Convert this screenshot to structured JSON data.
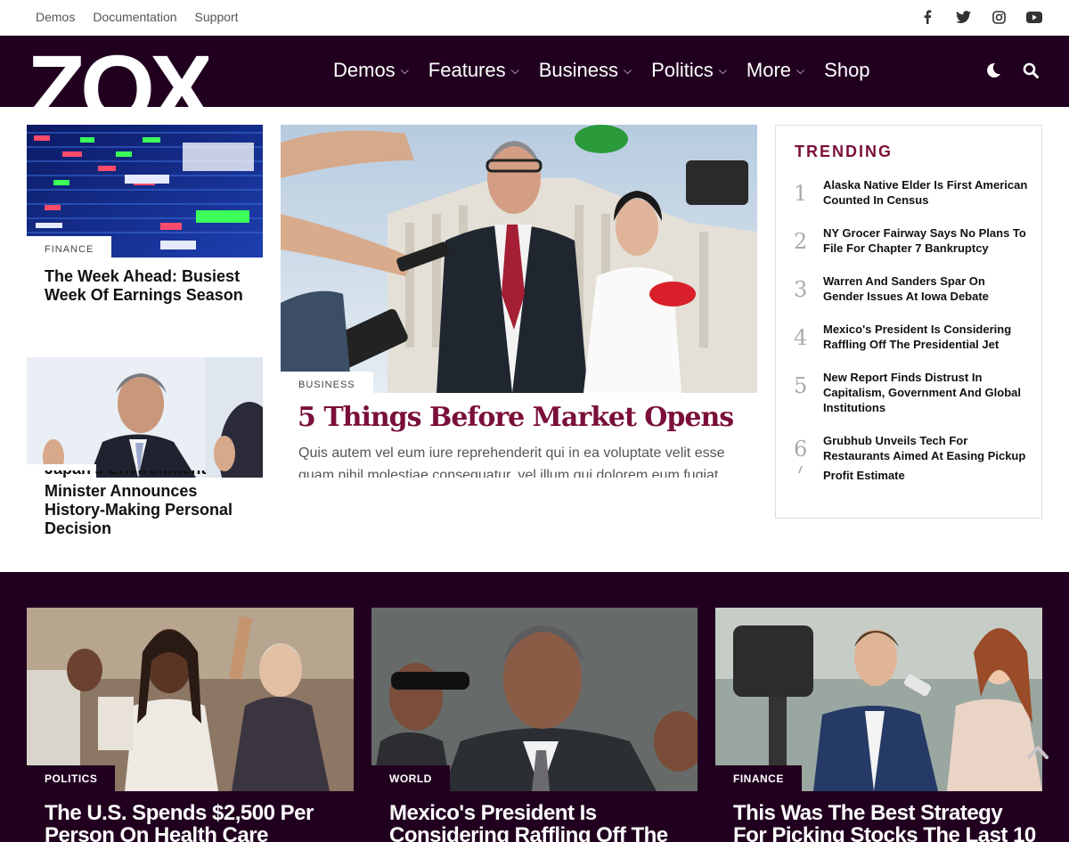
{
  "topbar": {
    "links": [
      "Demos",
      "Documentation",
      "Support"
    ],
    "social_icons": [
      "facebook-icon",
      "twitter-icon",
      "instagram-icon",
      "youtube-icon"
    ]
  },
  "nav": {
    "logo": "ZOX",
    "menu": [
      {
        "label": "Demos",
        "has_dropdown": true
      },
      {
        "label": "Features",
        "has_dropdown": true
      },
      {
        "label": "Business",
        "has_dropdown": true
      },
      {
        "label": "Politics",
        "has_dropdown": true
      },
      {
        "label": "More",
        "has_dropdown": true
      },
      {
        "label": "Shop",
        "has_dropdown": false
      }
    ],
    "icons": [
      "moon-icon",
      "search-icon"
    ],
    "chevron": "⌄"
  },
  "featured": {
    "left_top": {
      "category": "FINANCE",
      "title": "The Week Ahead: Busiest Week Of Earnings Season"
    },
    "left_bottom": {
      "category": "",
      "title_clipped": "Japan's Environment",
      "title": "Minister Announces History-Making Personal Decision"
    },
    "lead": {
      "category": "BUSINESS",
      "title": "5 Things Before Market Opens",
      "excerpt": "Quis autem vel eum iure reprehenderit qui in ea voluptate velit esse quam nihil molestiae consequatur, vel illum qui dolorem eum fugiat."
    }
  },
  "trending": {
    "heading": "TRENDING",
    "items": [
      {
        "num": "1",
        "title": "Alaska Native Elder Is First American Counted In Census"
      },
      {
        "num": "2",
        "title": "NY Grocer Fairway Says No Plans To File For Chapter 7 Bankruptcy"
      },
      {
        "num": "3",
        "title": "Warren And Sanders Spar On Gender Issues At Iowa Debate"
      },
      {
        "num": "4",
        "title": "Mexico's President Is Considering Raffling Off The Presidential Jet"
      },
      {
        "num": "5",
        "title": "New Report Finds Distrust In Capitalism, Government And Global Institutions"
      },
      {
        "num": "6",
        "title": "Grubhub Unveils Tech For Restaurants Aimed At Easing Pickup Orders"
      },
      {
        "num": "7",
        "title": "Profit Estimate"
      }
    ]
  },
  "band": {
    "cards": [
      {
        "category": "POLITICS",
        "title": "The U.S. Spends $2,500 Per Person On Health Care"
      },
      {
        "category": "WORLD",
        "title": "Mexico's President Is Considering Raffling Off The"
      },
      {
        "category": "FINANCE",
        "title": "This Was The Best Strategy For Picking Stocks The Last 10"
      }
    ]
  },
  "colors": {
    "brand_dark": "#21001f",
    "accent": "#7a0f3a"
  }
}
